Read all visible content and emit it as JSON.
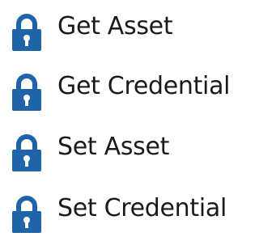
{
  "activities": {
    "items": [
      {
        "label": "Get Asset",
        "icon": "lock-icon"
      },
      {
        "label": "Get Credential",
        "icon": "lock-icon"
      },
      {
        "label": "Set Asset",
        "icon": "lock-icon"
      },
      {
        "label": "Set Credential",
        "icon": "lock-icon"
      }
    ]
  },
  "colors": {
    "lock": "#1f63a8",
    "text": "#1a1a1a"
  }
}
